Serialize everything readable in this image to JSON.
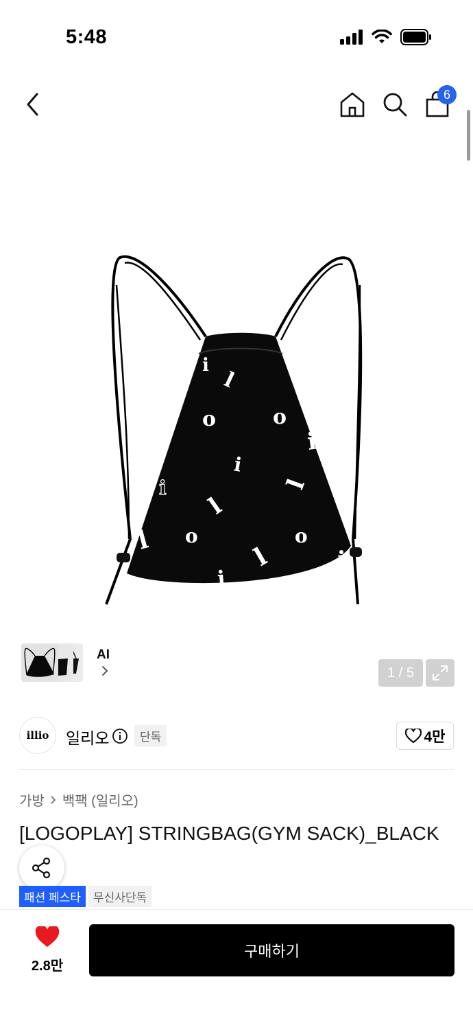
{
  "status_bar": {
    "time": "5:48"
  },
  "nav": {
    "back_icon": "chevron-left-icon",
    "home_icon": "home-icon",
    "search_icon": "search-icon",
    "cart_icon": "shopping-bag-icon",
    "cart_count": "6"
  },
  "gallery": {
    "ai_label": "AI",
    "pager": "1 / 5",
    "expand_icon": "expand-icon"
  },
  "brand": {
    "logo_text": "illio",
    "name": "일리오",
    "exclusive_tag": "단독",
    "like_count": "4만"
  },
  "product": {
    "breadcrumb": [
      "가방",
      "백팩 (일리오)"
    ],
    "title": "[LOGOPLAY] STRINGBAG(GYM SACK)_BLACK",
    "tags": [
      "패션 페스타",
      "무신사단독"
    ]
  },
  "bottom": {
    "wish_count": "2.8만",
    "buy_label": "구매하기"
  },
  "colors": {
    "accent_blue": "#1f5fff",
    "badge_blue": "#2563eb",
    "heart_red": "#e8191f",
    "buy_button": "#000000"
  }
}
